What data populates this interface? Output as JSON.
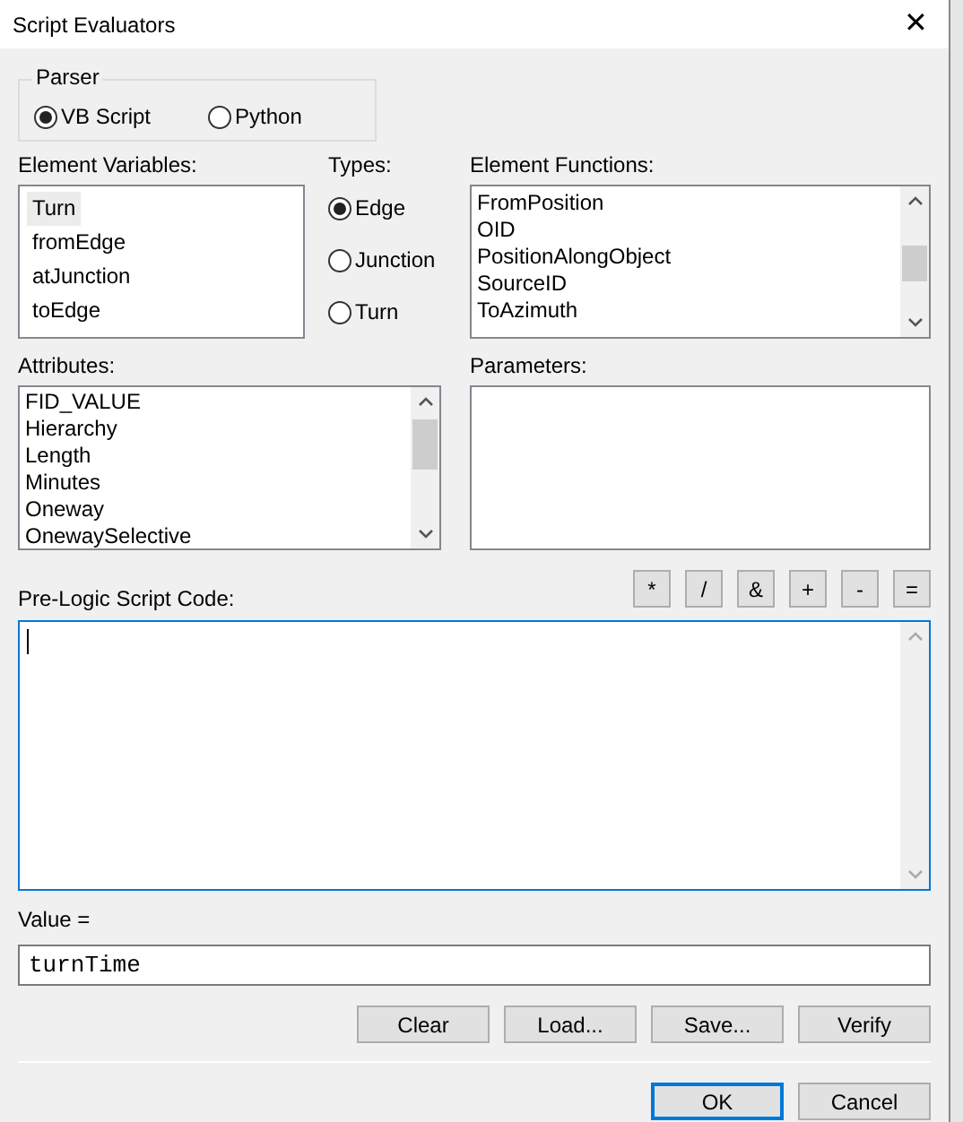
{
  "window": {
    "title": "Script Evaluators",
    "close_icon": "✕"
  },
  "parser": {
    "label": "Parser",
    "options": [
      {
        "label": "VB Script",
        "selected": true
      },
      {
        "label": "Python",
        "selected": false
      }
    ]
  },
  "element_variables": {
    "label": "Element Variables:",
    "items": [
      {
        "label": "Turn",
        "selected": true
      },
      {
        "label": "fromEdge",
        "selected": false
      },
      {
        "label": "atJunction",
        "selected": false
      },
      {
        "label": "toEdge",
        "selected": false
      }
    ]
  },
  "types": {
    "label": "Types:",
    "options": [
      {
        "label": "Edge",
        "selected": true
      },
      {
        "label": "Junction",
        "selected": false
      },
      {
        "label": "Turn",
        "selected": false
      }
    ]
  },
  "element_functions": {
    "label": "Element Functions:",
    "items": [
      "FromPosition",
      "OID",
      "PositionAlongObject",
      "SourceID",
      "ToAzimuth"
    ]
  },
  "attributes": {
    "label": "Attributes:",
    "items": [
      "FID_VALUE",
      "Hierarchy",
      "Length",
      "Minutes",
      "Oneway",
      "OnewaySelective"
    ]
  },
  "parameters": {
    "label": "Parameters:"
  },
  "pre_logic": {
    "label": "Pre-Logic Script Code:",
    "operators": [
      "*",
      "/",
      "&",
      "+",
      "-",
      "="
    ]
  },
  "value": {
    "label": "Value =",
    "value": "turnTime"
  },
  "actions": [
    "Clear",
    "Load...",
    "Save...",
    "Verify"
  ],
  "footer_buttons": [
    {
      "label": "OK",
      "default": true
    },
    {
      "label": "Cancel",
      "default": false
    }
  ]
}
